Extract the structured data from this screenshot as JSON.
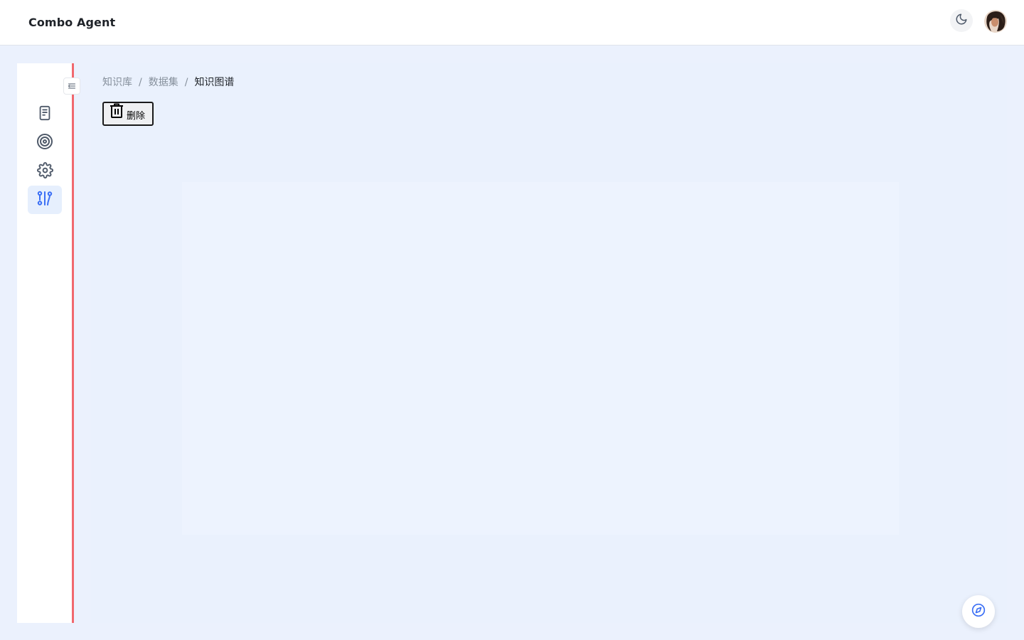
{
  "header": {
    "app_title": "Combo Agent",
    "theme_toggle_icon": "moon-icon",
    "avatar_icon": "user-avatar"
  },
  "sidebar": {
    "collapse_icon": "collapse-menu-icon",
    "items": [
      {
        "icon": "document-icon",
        "active": false
      },
      {
        "icon": "target-icon",
        "active": false
      },
      {
        "icon": "gear-icon",
        "active": false
      },
      {
        "icon": "knowledge-graph-icon",
        "active": true
      }
    ],
    "accent_color": "#3b6ff5",
    "edge_color": "#f0686e"
  },
  "breadcrumb": {
    "items": [
      "知识库",
      "数据集",
      "知识图谱"
    ],
    "separator": "/"
  },
  "toolbar": {
    "delete_label": "删除",
    "delete_icon": "trash-icon"
  },
  "fab": {
    "icon": "compass-icon"
  },
  "colors": {
    "background": "#ebf1fd",
    "primary": "#3b6ff5",
    "text": "#1f2329",
    "muted": "#86909c"
  }
}
